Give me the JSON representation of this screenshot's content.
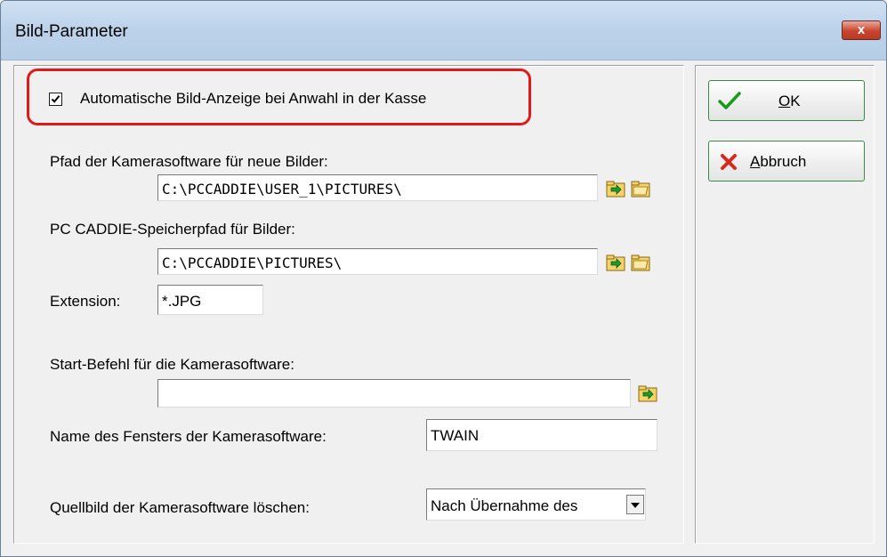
{
  "dialog": {
    "title": "Bild-Parameter",
    "close_label": "x"
  },
  "options": {
    "auto_display_label": "Automatische Bild-Anzeige bei Anwahl in der Kasse",
    "auto_display_checked": true
  },
  "fields": {
    "camera_path_label": "Pfad der Kamerasoftware für neue Bilder:",
    "camera_path_value": "C:\\PCCADDIE\\USER_1\\PICTURES\\",
    "storage_path_label": "PC CADDIE-Speicherpfad für Bilder:",
    "storage_path_value": "C:\\PCCADDIE\\PICTURES\\",
    "extension_label": "Extension:",
    "extension_value": "*.JPG",
    "start_command_label": "Start-Befehl für die Kamerasoftware:",
    "start_command_value": "",
    "window_name_label": "Name des Fensters der Kamerasoftware:",
    "window_name_value": "TWAIN",
    "delete_source_label": "Quellbild der Kamerasoftware löschen:",
    "delete_source_value": "Nach Übernahme des"
  },
  "buttons": {
    "ok_label_underlined": "O",
    "ok_label_rest": "K",
    "cancel_label_underlined": "A",
    "cancel_label_rest": "bbruch"
  },
  "colors": {
    "highlight": "#e01a1a",
    "button_border": "#3a8b46",
    "ok_check": "#1a9a1a",
    "cancel_x": "#d62a1f"
  }
}
